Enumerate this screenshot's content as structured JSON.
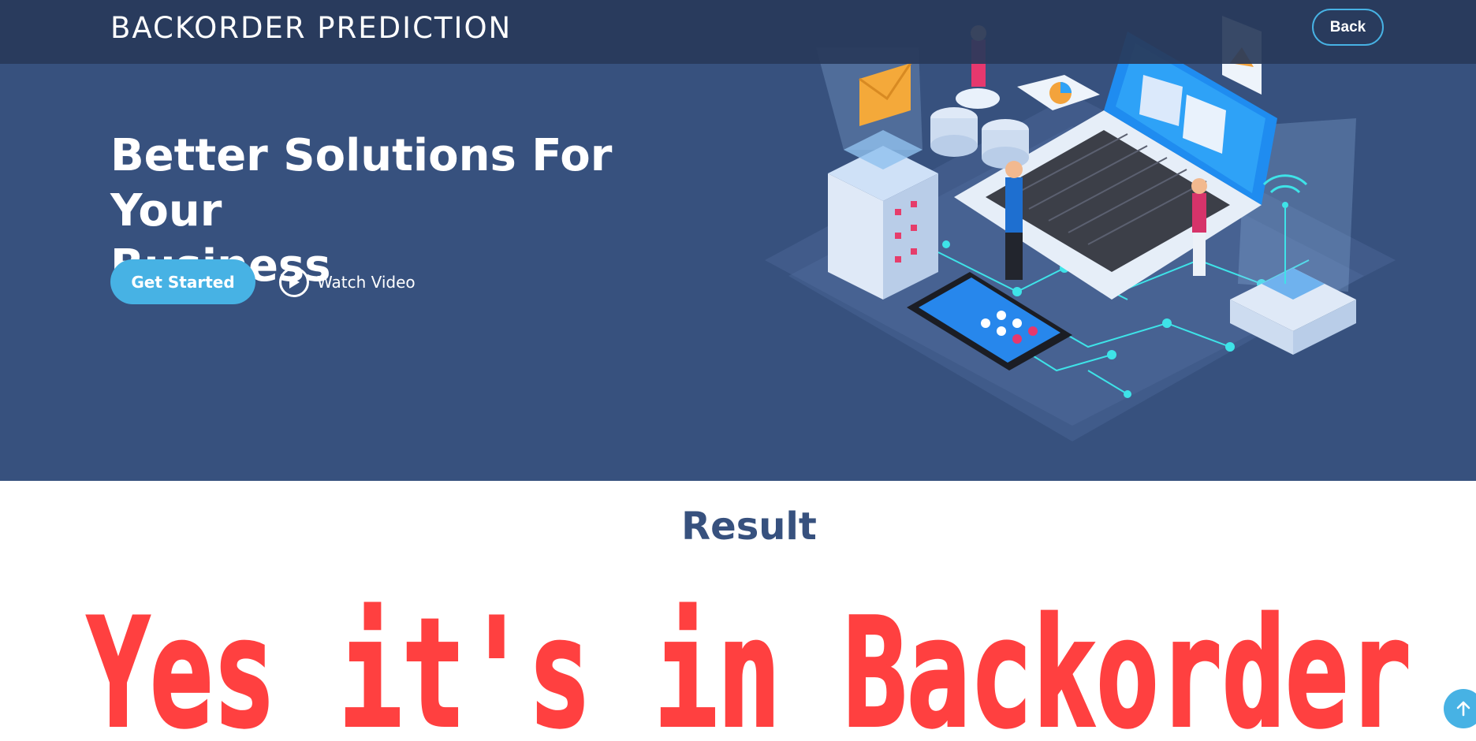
{
  "header": {
    "brand": "BACKORDER PREDICTION",
    "back_label": "Back"
  },
  "hero": {
    "headline_line1": "Better Solutions For Your",
    "headline_line2": "Business",
    "get_started_label": "Get Started",
    "watch_video_label": "Watch Video"
  },
  "result": {
    "title": "Result",
    "prediction_text": "Yes it's in Backorder"
  },
  "icons": {
    "play": "play-circle-icon",
    "back_to_top": "arrow-up-icon"
  },
  "colors": {
    "hero_bg": "#37517e",
    "header_bg": "#283a5a",
    "accent": "#47b2e4",
    "prediction_red": "#ff4040",
    "result_title": "#37517e"
  }
}
